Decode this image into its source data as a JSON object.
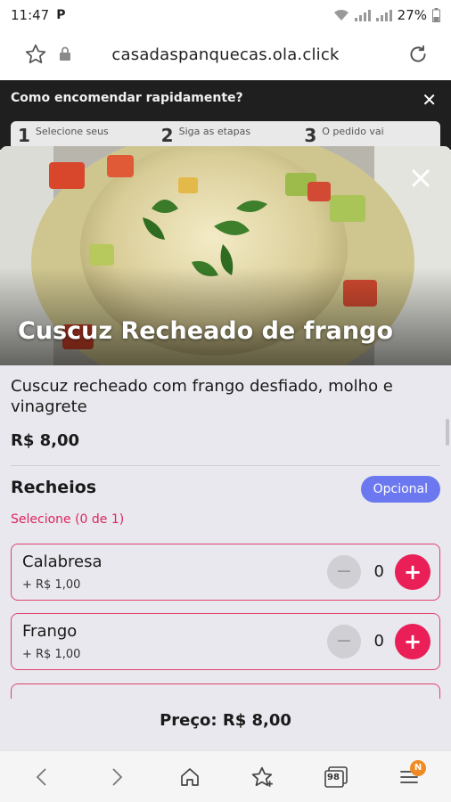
{
  "status_bar": {
    "time": "11:47",
    "app_icon": "P",
    "battery": "27%"
  },
  "browser": {
    "url": "casadaspanquecas.ola.click"
  },
  "background_page": {
    "hint": "Como encomendar rapidamente?",
    "steps": [
      {
        "num": "1",
        "text": "Selecione seus"
      },
      {
        "num": "2",
        "text": "Siga as etapas"
      },
      {
        "num": "3",
        "text": "O pedido vai"
      }
    ]
  },
  "product": {
    "title": "Cuscuz Recheado de frango",
    "description": "Cuscuz recheado com frango desfiado,   molho e vinagrete",
    "price": "R$ 8,00"
  },
  "group": {
    "title": "Recheios",
    "badge": "Opcional",
    "hint": "Selecione (0 de 1)",
    "options": [
      {
        "name": "Calabresa",
        "extra": "+ R$ 1,00",
        "qty": "0",
        "minus": "−",
        "plus": "+"
      },
      {
        "name": "Frango",
        "extra": "+ R$ 1,00",
        "qty": "0",
        "minus": "−",
        "plus": "+"
      }
    ]
  },
  "footer": {
    "total": "Preço: R$ 8,00"
  },
  "bottom_nav": {
    "tabs_count": "98",
    "notif": "N"
  },
  "colors": {
    "accent": "#ea1f57",
    "badge": "#6c78f0",
    "hint": "#e0245e"
  }
}
